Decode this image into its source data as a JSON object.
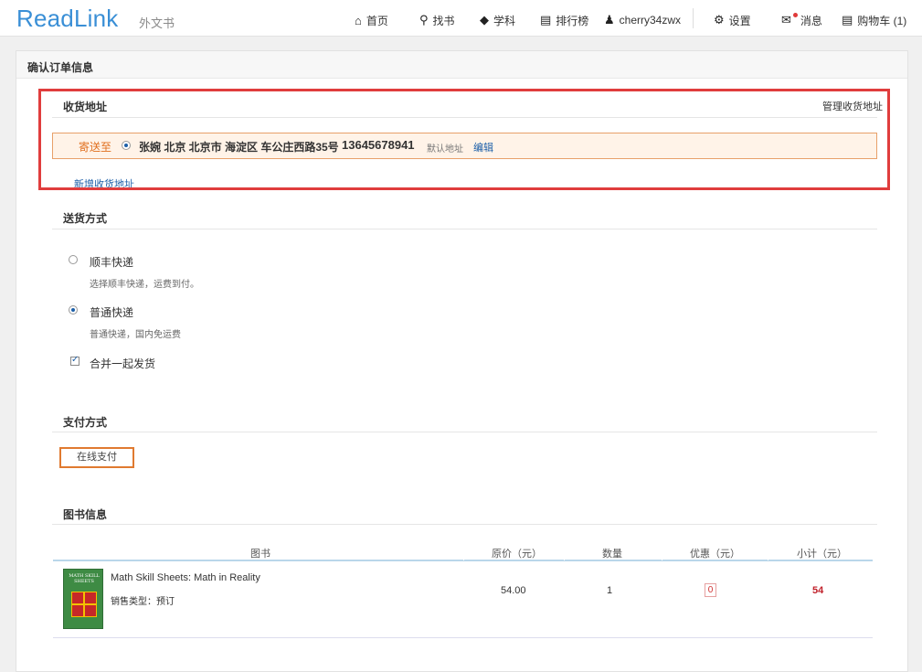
{
  "header": {
    "logo": "ReadLink",
    "logo_sub": "外文书",
    "nav": {
      "home": "首页",
      "search": "找书",
      "subject": "学科",
      "ranking": "排行榜",
      "user": "cherry34zwx",
      "settings": "设置",
      "messages": "消息",
      "cart": "购物车 (1)"
    }
  },
  "page": {
    "title": "确认订单信息"
  },
  "address": {
    "section_title": "收货地址",
    "manage": "管理收货地址",
    "send_to": "寄送至",
    "line": "张婉  北京 北京市 海淀区 车公庄西路35号",
    "phone": "13645678941",
    "default_tag": "默认地址",
    "edit": "编辑",
    "add_new": "新增收货地址"
  },
  "delivery": {
    "section_title": "送货方式",
    "options": [
      {
        "label": "顺丰快递",
        "desc": "选择顺丰快递，运费到付。",
        "selected": false
      },
      {
        "label": "普通快递",
        "desc": "普通快递，国内免运费",
        "selected": true
      }
    ],
    "merge_label": "合并一起发货",
    "merge_checked": true
  },
  "payment": {
    "section_title": "支付方式",
    "online": "在线支付"
  },
  "books": {
    "section_title": "图书信息",
    "columns": [
      "图书",
      "原价（元）",
      "数量",
      "优惠（元）",
      "小计（元）"
    ],
    "rows": [
      {
        "cover_text": "MATH SKILL SHEETS",
        "title": "Math Skill Sheets: Math in Reality",
        "sale_type": "销售类型：预订",
        "price": "54.00",
        "qty": "1",
        "discount": "0",
        "subtotal": "54"
      }
    ]
  },
  "colors": {
    "brand_blue": "#3a8fd6",
    "link_blue": "#1c5fa8",
    "highlight_red": "#e03d3d",
    "orange": "#e07020"
  }
}
